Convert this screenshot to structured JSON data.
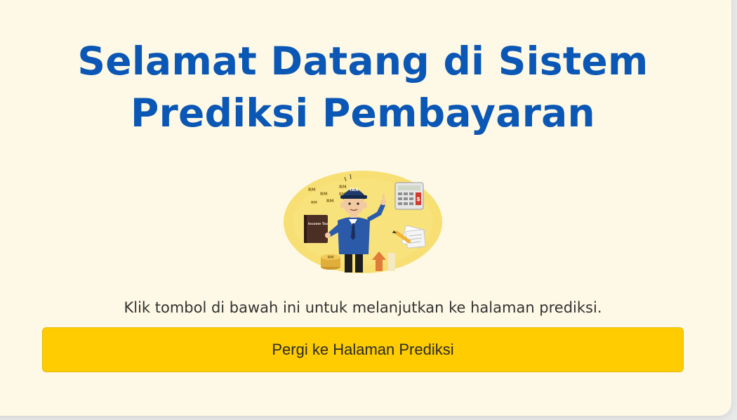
{
  "page": {
    "title_line1": "Selamat Datang di Sistem",
    "title_line2": "Prediksi Pembayaran",
    "subtitle": "Klik tombol di bawah ini untuk melanjutkan ke halaman prediksi.",
    "button_label": "Pergi ke Halaman Prediksi"
  },
  "illustration": {
    "hat_label": "TAX",
    "book_label": "Income Tax",
    "currency_marks": [
      "RM",
      "RM",
      "RM",
      "RM",
      "RM",
      "RM",
      "RM"
    ],
    "calculator_mark": "$"
  },
  "colors": {
    "background": "#fef9e6",
    "title": "#0b57b5",
    "button": "#fecc00",
    "illustration_bg": "#f7df73"
  }
}
